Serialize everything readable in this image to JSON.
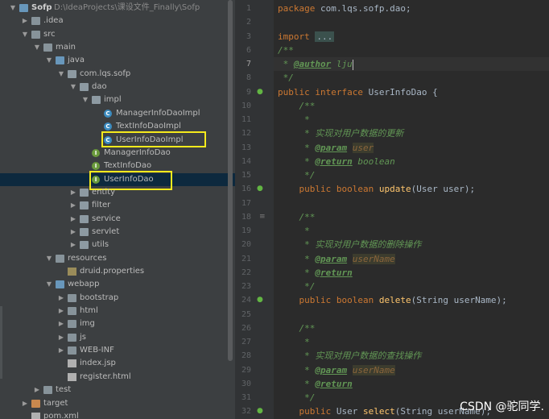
{
  "project_tree": {
    "root": {
      "name": "Sofp",
      "path": "D:\\IdeaProjects\\课设文件_Finally\\Sofp"
    },
    "nodes": [
      {
        "label": "Sofp",
        "extra": "D:\\IdeaProjects\\课设文件_Finally\\Sofp",
        "icon": "module-folder-icon",
        "depth": 0,
        "expanded": true
      },
      {
        "label": ".idea",
        "icon": "folder-icon",
        "depth": 1,
        "expanded": false
      },
      {
        "label": "src",
        "icon": "folder-icon",
        "depth": 1,
        "expanded": true
      },
      {
        "label": "main",
        "icon": "folder-icon",
        "depth": 2,
        "expanded": true
      },
      {
        "label": "java",
        "icon": "source-folder-icon",
        "depth": 3,
        "expanded": true
      },
      {
        "label": "com.lqs.sofp",
        "icon": "package-icon",
        "depth": 4,
        "expanded": true
      },
      {
        "label": "dao",
        "icon": "package-icon",
        "depth": 5,
        "expanded": true
      },
      {
        "label": "impl",
        "icon": "package-icon",
        "depth": 6,
        "expanded": true
      },
      {
        "label": "ManagerInfoDaoImpl",
        "icon": "class-icon",
        "depth": 7
      },
      {
        "label": "TextInfoDaoImpl",
        "icon": "class-icon",
        "depth": 7
      },
      {
        "label": "UserInfoDaoImpl",
        "icon": "class-icon",
        "depth": 7,
        "highlighted": true
      },
      {
        "label": "ManagerInfoDao",
        "icon": "interface-icon",
        "depth": 6
      },
      {
        "label": "TextInfoDao",
        "icon": "interface-icon",
        "depth": 6
      },
      {
        "label": "UserInfoDao",
        "icon": "interface-icon",
        "depth": 6,
        "highlighted": true,
        "selected": true
      },
      {
        "label": "entity",
        "icon": "package-icon",
        "depth": 5,
        "expanded": false
      },
      {
        "label": "filter",
        "icon": "package-icon",
        "depth": 5,
        "expanded": false
      },
      {
        "label": "service",
        "icon": "package-icon",
        "depth": 5,
        "expanded": false
      },
      {
        "label": "servlet",
        "icon": "package-icon",
        "depth": 5,
        "expanded": false
      },
      {
        "label": "utils",
        "icon": "package-icon",
        "depth": 5,
        "expanded": false
      },
      {
        "label": "resources",
        "icon": "resources-folder-icon",
        "depth": 3,
        "expanded": true
      },
      {
        "label": "druid.properties",
        "icon": "properties-file-icon",
        "depth": 4
      },
      {
        "label": "webapp",
        "icon": "web-folder-icon",
        "depth": 3,
        "expanded": true
      },
      {
        "label": "bootstrap",
        "icon": "folder-icon",
        "depth": 4,
        "expanded": false
      },
      {
        "label": "html",
        "icon": "folder-icon",
        "depth": 4,
        "expanded": false
      },
      {
        "label": "img",
        "icon": "folder-icon",
        "depth": 4,
        "expanded": false
      },
      {
        "label": "js",
        "icon": "folder-icon",
        "depth": 4,
        "expanded": false
      },
      {
        "label": "WEB-INF",
        "icon": "folder-icon",
        "depth": 4,
        "expanded": false
      },
      {
        "label": "index.jsp",
        "icon": "file-icon",
        "depth": 4
      },
      {
        "label": "register.html",
        "icon": "file-icon",
        "depth": 4
      },
      {
        "label": "test",
        "icon": "folder-icon",
        "depth": 2,
        "expanded": false
      },
      {
        "label": "target",
        "icon": "excluded-folder-icon",
        "depth": 1,
        "expanded": false
      },
      {
        "label": "pom.xml",
        "icon": "file-icon",
        "depth": 1
      }
    ]
  },
  "editor": {
    "line_numbers": [
      "1",
      "2",
      "3",
      "6",
      "7",
      "8",
      "9",
      "10",
      "11",
      "12",
      "13",
      "14",
      "15",
      "16",
      "17",
      "18",
      "19",
      "20",
      "21",
      "22",
      "23",
      "24",
      "25",
      "26",
      "27",
      "28",
      "29",
      "30",
      "31",
      "32"
    ],
    "current_line": "7",
    "lines": [
      {
        "n": "1",
        "tokens": [
          {
            "t": "package ",
            "c": "kw"
          },
          {
            "t": "com.lqs.sofp.dao;",
            "c": "plain"
          }
        ]
      },
      {
        "n": "2",
        "tokens": []
      },
      {
        "n": "3",
        "tokens": [
          {
            "t": "import ",
            "c": "kw"
          },
          {
            "t": "...",
            "c": "foldbox"
          }
        ]
      },
      {
        "n": "6",
        "tokens": [
          {
            "t": "/**",
            "c": "cm"
          }
        ]
      },
      {
        "n": "7",
        "tokens": [
          {
            "t": " * ",
            "c": "cm"
          },
          {
            "t": "@author",
            "c": "tag"
          },
          {
            "t": " lju",
            "c": "cm"
          }
        ]
      },
      {
        "n": "8",
        "tokens": [
          {
            "t": " */",
            "c": "cm"
          }
        ]
      },
      {
        "n": "9",
        "tokens": [
          {
            "t": "public interface ",
            "c": "kw"
          },
          {
            "t": "UserInfoDao {",
            "c": "plain"
          }
        ]
      },
      {
        "n": "10",
        "tokens": [
          {
            "t": "    /**",
            "c": "cm"
          }
        ]
      },
      {
        "n": "11",
        "tokens": [
          {
            "t": "     *",
            "c": "cm"
          }
        ]
      },
      {
        "n": "12",
        "tokens": [
          {
            "t": "     * 实现对用户数据的更新",
            "c": "cm"
          }
        ]
      },
      {
        "n": "13",
        "tokens": [
          {
            "t": "     * ",
            "c": "cm"
          },
          {
            "t": "@param",
            "c": "tag"
          },
          {
            "t": " ",
            "c": "cm"
          },
          {
            "t": "user",
            "c": "pnm"
          }
        ]
      },
      {
        "n": "14",
        "tokens": [
          {
            "t": "     * ",
            "c": "cm"
          },
          {
            "t": "@return",
            "c": "tag"
          },
          {
            "t": " boolean",
            "c": "cm"
          }
        ]
      },
      {
        "n": "15",
        "tokens": [
          {
            "t": "     */",
            "c": "cm"
          }
        ]
      },
      {
        "n": "16",
        "tokens": [
          {
            "t": "    public boolean ",
            "c": "kw"
          },
          {
            "t": "update",
            "c": "fn"
          },
          {
            "t": "(User user);",
            "c": "plain"
          }
        ]
      },
      {
        "n": "17",
        "tokens": []
      },
      {
        "n": "18",
        "tokens": [
          {
            "t": "    /**",
            "c": "cm"
          }
        ]
      },
      {
        "n": "19",
        "tokens": [
          {
            "t": "     *",
            "c": "cm"
          }
        ]
      },
      {
        "n": "20",
        "tokens": [
          {
            "t": "     * 实现对用户数据的删除操作",
            "c": "cm"
          }
        ]
      },
      {
        "n": "21",
        "tokens": [
          {
            "t": "     * ",
            "c": "cm"
          },
          {
            "t": "@param",
            "c": "tag"
          },
          {
            "t": " ",
            "c": "cm"
          },
          {
            "t": "userName",
            "c": "pnm"
          }
        ]
      },
      {
        "n": "22",
        "tokens": [
          {
            "t": "     * ",
            "c": "cm"
          },
          {
            "t": "@return",
            "c": "tag"
          }
        ]
      },
      {
        "n": "23",
        "tokens": [
          {
            "t": "     */",
            "c": "cm"
          }
        ]
      },
      {
        "n": "24",
        "tokens": [
          {
            "t": "    public boolean ",
            "c": "kw"
          },
          {
            "t": "delete",
            "c": "fn"
          },
          {
            "t": "(String userName);",
            "c": "plain"
          }
        ]
      },
      {
        "n": "25",
        "tokens": []
      },
      {
        "n": "26",
        "tokens": [
          {
            "t": "    /**",
            "c": "cm"
          }
        ]
      },
      {
        "n": "27",
        "tokens": [
          {
            "t": "     *",
            "c": "cm"
          }
        ]
      },
      {
        "n": "28",
        "tokens": [
          {
            "t": "     * 实现对用户数据的查找操作",
            "c": "cm"
          }
        ]
      },
      {
        "n": "29",
        "tokens": [
          {
            "t": "     * ",
            "c": "cm"
          },
          {
            "t": "@param",
            "c": "tag"
          },
          {
            "t": " ",
            "c": "cm"
          },
          {
            "t": "userName",
            "c": "pnm"
          }
        ]
      },
      {
        "n": "30",
        "tokens": [
          {
            "t": "     * ",
            "c": "cm"
          },
          {
            "t": "@return",
            "c": "tag"
          }
        ]
      },
      {
        "n": "31",
        "tokens": [
          {
            "t": "     */",
            "c": "cm"
          }
        ]
      },
      {
        "n": "32",
        "tokens": [
          {
            "t": "    public ",
            "c": "kw"
          },
          {
            "t": "User ",
            "c": "plain"
          },
          {
            "t": "select",
            "c": "fn"
          },
          {
            "t": "(String userName);",
            "c": "plain"
          }
        ]
      }
    ],
    "gutter_icons": [
      {
        "line": "9",
        "icon": "implemented-icon"
      },
      {
        "line": "16",
        "icon": "implemented-icon"
      },
      {
        "line": "18",
        "icon": "fold-icon"
      },
      {
        "line": "24",
        "icon": "implemented-icon"
      },
      {
        "line": "32",
        "icon": "implemented-icon"
      }
    ]
  },
  "watermark": "CSDN @驼同学.",
  "colors": {
    "highlight_box": "#f5ea1c",
    "keyword": "#cc7832",
    "comment": "#629755",
    "method": "#ffc66d",
    "selection": "#0d293e"
  }
}
